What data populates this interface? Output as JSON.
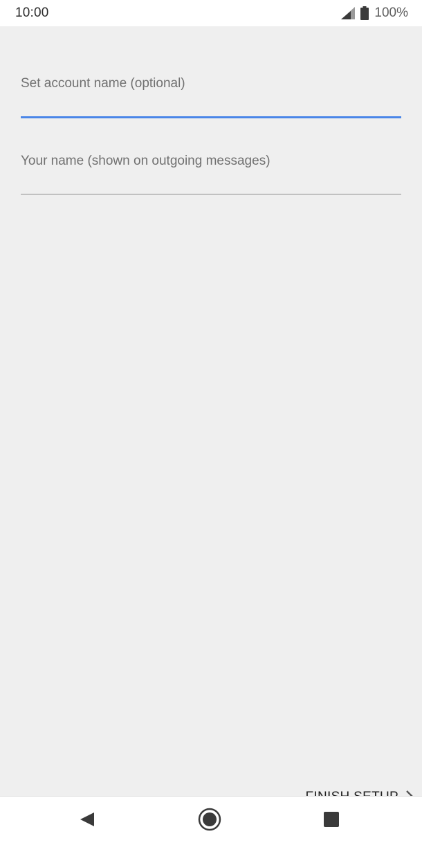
{
  "status_bar": {
    "time": "10:00",
    "battery_percent": "100%",
    "icons": [
      "signal-icon",
      "battery-icon"
    ]
  },
  "form": {
    "account_name_label": "Set account name (optional)",
    "account_name_value": "",
    "your_name_label": "Your name (shown on outgoing messages)",
    "your_name_value": ""
  },
  "actions": {
    "finish_label": "FINISH SETUP",
    "finish_icon": "chevron-right-icon"
  },
  "nav_bar": {
    "icons": [
      "back-icon",
      "home-icon",
      "recents-icon"
    ]
  },
  "colors": {
    "accent": "#4a86e8",
    "background": "#efefef",
    "label": "#707070"
  }
}
